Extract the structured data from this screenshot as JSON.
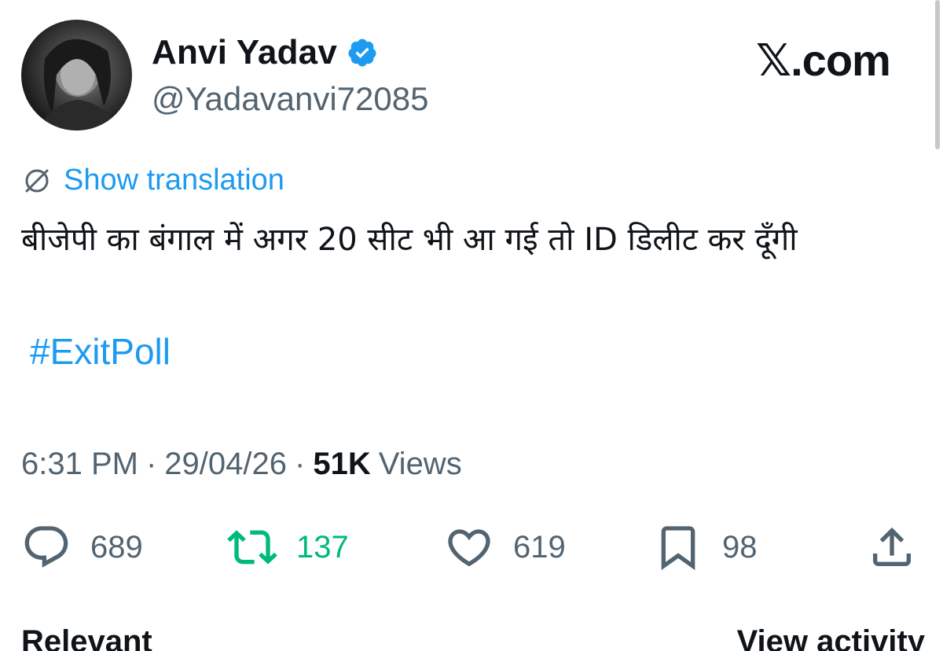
{
  "author": {
    "display_name": "Anvi Yadav",
    "handle": "@Yadavanvi72085",
    "verified": true
  },
  "brand": {
    "watermark": "𝕏.com"
  },
  "translate": {
    "label": "Show translation"
  },
  "tweet": {
    "text": "बीजेपी का बंगाल में अगर 20 सीट भी आ गई तो ID डिलीट कर दूँगी",
    "hashtag": "#ExitPoll"
  },
  "meta": {
    "time": "6:31 PM",
    "sep1": "·",
    "date": "29/04/26",
    "sep2": "·",
    "views_count": "51K",
    "views_label": "Views"
  },
  "actions": {
    "replies": "689",
    "retweets": "137",
    "likes": "619",
    "bookmarks": "98"
  },
  "cut_row": {
    "left": "Relevant",
    "right": "View activity"
  },
  "colors": {
    "link": "#1d9bf0",
    "retweet": "#00ba7c",
    "secondary": "#536471",
    "text": "#0f1419"
  }
}
